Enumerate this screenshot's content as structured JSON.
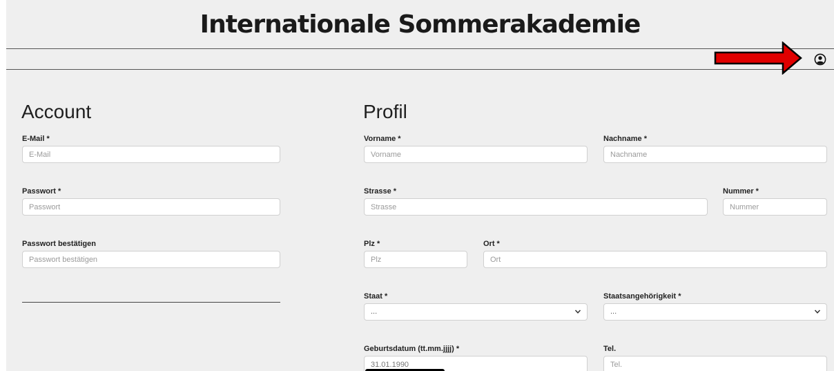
{
  "header": {
    "title": "Internationale Sommerakademie"
  },
  "icons": {
    "user": "user-circle-icon",
    "arrow": "red-arrow-right"
  },
  "colors": {
    "arrow_fill": "#e00000",
    "background": "#efefef"
  },
  "account": {
    "heading": "Account",
    "email": {
      "label": "E-Mail *",
      "placeholder": "E-Mail"
    },
    "password": {
      "label": "Passwort *",
      "placeholder": "Passwort"
    },
    "password_confirm": {
      "label": "Passwort bestätigen",
      "placeholder": "Passwort bestätigen"
    }
  },
  "profil": {
    "heading": "Profil",
    "vorname": {
      "label": "Vorname *",
      "placeholder": "Vorname"
    },
    "nachname": {
      "label": "Nachname *",
      "placeholder": "Nachname"
    },
    "strasse": {
      "label": "Strasse *",
      "placeholder": "Strasse"
    },
    "nummer": {
      "label": "Nummer *",
      "placeholder": "Nummer"
    },
    "plz": {
      "label": "Plz *",
      "placeholder": "Plz"
    },
    "ort": {
      "label": "Ort *",
      "placeholder": "Ort"
    },
    "staat": {
      "label": "Staat *",
      "value": "..."
    },
    "staatsangehoerigkeit": {
      "label": "Staatsangehörigkeit *",
      "value": "..."
    },
    "geburtsdatum": {
      "label": "Geburtsdatum (tt.mm.jjjj) *",
      "value": "31.01.1990"
    },
    "tel": {
      "label": "Tel.",
      "placeholder": "Tel."
    }
  }
}
